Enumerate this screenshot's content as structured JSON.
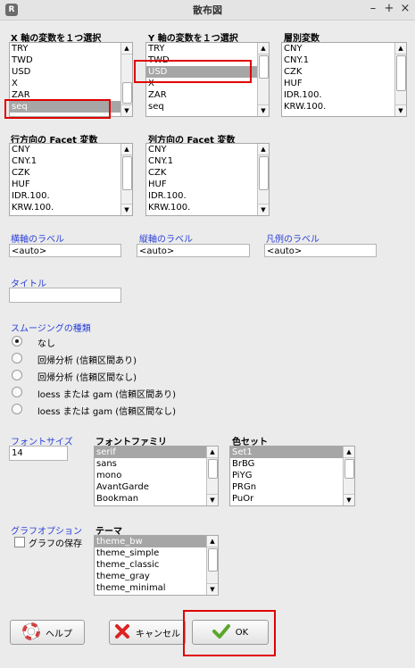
{
  "window": {
    "title": "散布図"
  },
  "x_var": {
    "label": "X 軸の変数を１つ選択",
    "items": [
      "TRY",
      "TWD",
      "USD",
      "X",
      "ZAR",
      "seq"
    ],
    "selected": 5
  },
  "y_var": {
    "label": "Y 軸の変数を１つ選択",
    "items": [
      "TRY",
      "TWD",
      "USD",
      "X",
      "ZAR",
      "seq"
    ],
    "selected": 2
  },
  "strata": {
    "label": "層別変数",
    "items": [
      "CNY",
      "CNY.1",
      "CZK",
      "HUF",
      "IDR.100.",
      "KRW.100."
    ]
  },
  "facet_row": {
    "label": "行方向の Facet 変数",
    "items": [
      "CNY",
      "CNY.1",
      "CZK",
      "HUF",
      "IDR.100.",
      "KRW.100."
    ]
  },
  "facet_col": {
    "label": "列方向の Facet 変数",
    "items": [
      "CNY",
      "CNY.1",
      "CZK",
      "HUF",
      "IDR.100.",
      "KRW.100."
    ]
  },
  "labels": {
    "x_label": "横軸のラベル",
    "y_label": "縦軸のラベル",
    "legend_label": "凡例のラベル",
    "x_value": "<auto>",
    "y_value": "<auto>",
    "legend_value": "<auto>",
    "title_label": "タイトル",
    "title_value": ""
  },
  "smoothing": {
    "label": "スムージングの種類",
    "options": [
      "なし",
      "回帰分析 (信頼区間あり)",
      "回帰分析 (信頼区間なし)",
      "loess または gam (信頼区間あり)",
      "loess または gam (信頼区間なし)"
    ],
    "selected": 0
  },
  "font_size": {
    "label": "フォントサイズ",
    "value": "14"
  },
  "font_family": {
    "label": "フォントファミリ",
    "items": [
      "serif",
      "sans",
      "mono",
      "AvantGarde",
      "Bookman"
    ],
    "selected": 0
  },
  "color_set": {
    "label": "色セット",
    "items": [
      "Set1",
      "BrBG",
      "PiYG",
      "PRGn",
      "PuOr"
    ],
    "selected": 0
  },
  "graph_options": {
    "label": "グラフオプション",
    "save_label": "グラフの保存",
    "save_checked": false
  },
  "theme": {
    "label": "テーマ",
    "items": [
      "theme_bw",
      "theme_simple",
      "theme_classic",
      "theme_gray",
      "theme_minimal"
    ],
    "selected": 0
  },
  "buttons": {
    "help": "ヘルプ",
    "cancel": "キャンセル",
    "ok": "OK"
  }
}
